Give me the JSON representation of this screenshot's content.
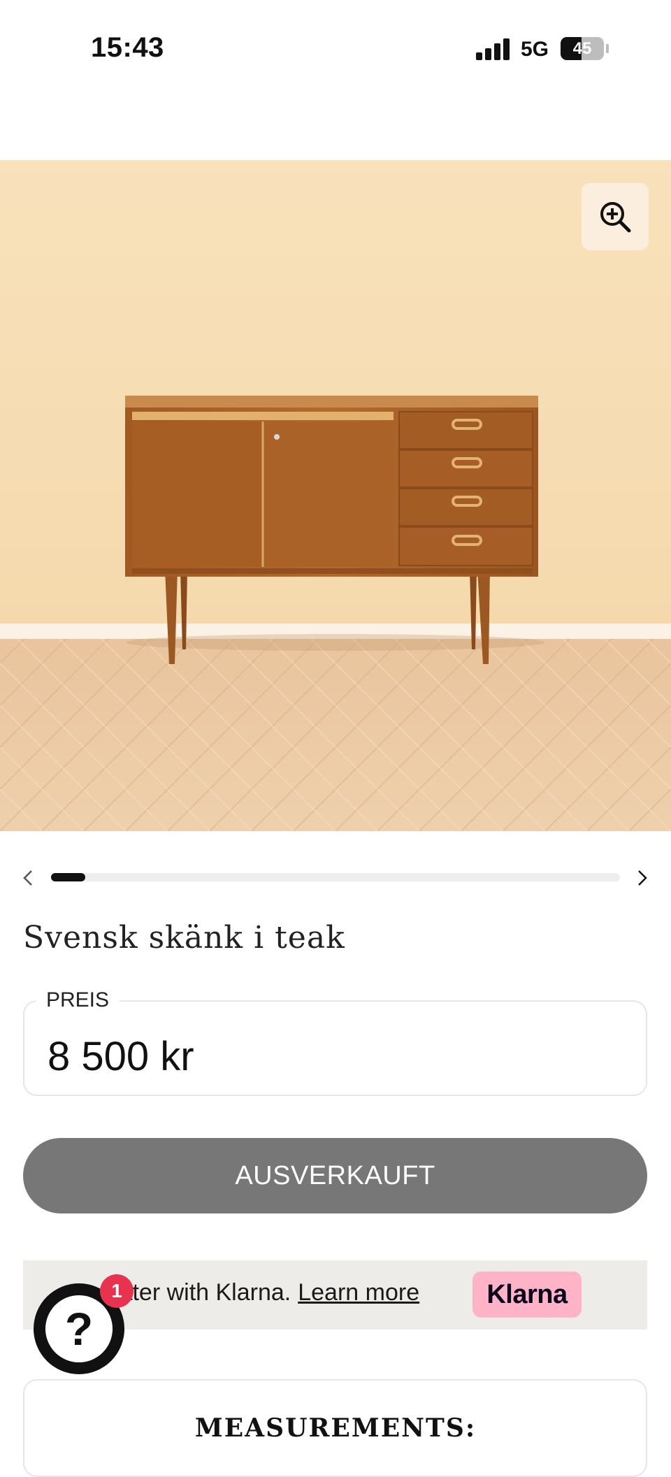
{
  "status_bar": {
    "time": "15:43",
    "network": "5G",
    "battery": "45"
  },
  "product": {
    "title": "Svensk skänk i teak",
    "price_label": "PREIS",
    "price": "8 500 kr",
    "sold_out_label": "AUSVERKAUFT",
    "gallery_progress": 0.06
  },
  "klarna": {
    "text": "later with Klarna.",
    "link": "Learn more",
    "logo": "Klarna"
  },
  "help": {
    "icon": "?",
    "badge": "1"
  },
  "measurements": {
    "title": "MEASUREMENTS:"
  },
  "colors": {
    "sold_out_bg": "#777777",
    "klarna_pink": "#ffb3c7",
    "badge_red": "#e7334f",
    "wall": "#f7dfb6",
    "floor": "#ebc9a2",
    "teak": "#a55d24"
  },
  "icons": {
    "zoom": "zoom-in-icon",
    "prev": "chevron-left-icon",
    "next": "chevron-right-icon",
    "help": "question-icon"
  }
}
